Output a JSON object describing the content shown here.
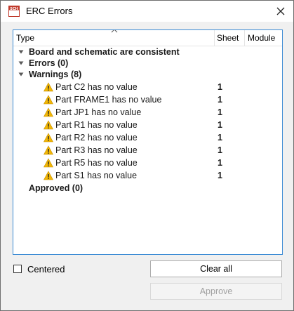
{
  "window": {
    "title": "ERC Errors",
    "app_icon_text": "SCH"
  },
  "table": {
    "columns": [
      "Type",
      "Sheet",
      "Module"
    ],
    "groups": [
      {
        "label": "Board and schematic are consistent",
        "expanded": false
      },
      {
        "label": "Errors (0)",
        "expanded": false
      },
      {
        "label": "Warnings (8)",
        "expanded": true
      }
    ],
    "warnings": [
      {
        "label": "Part C2 has no value",
        "sheet": "1"
      },
      {
        "label": "Part FRAME1 has no value",
        "sheet": "1"
      },
      {
        "label": "Part JP1 has no value",
        "sheet": "1"
      },
      {
        "label": "Part R1 has no value",
        "sheet": "1"
      },
      {
        "label": "Part R2 has no value",
        "sheet": "1"
      },
      {
        "label": "Part R3 has no value",
        "sheet": "1"
      },
      {
        "label": "Part R5 has no value",
        "sheet": "1"
      },
      {
        "label": "Part S1 has no value",
        "sheet": "1"
      }
    ],
    "approved_label": "Approved (0)"
  },
  "footer": {
    "centered_label": "Centered",
    "centered_checked": false,
    "clear_all_label": "Clear all",
    "approve_label": "Approve"
  },
  "colors": {
    "accent": "#3c8bd4",
    "warning": "#f2b705"
  }
}
